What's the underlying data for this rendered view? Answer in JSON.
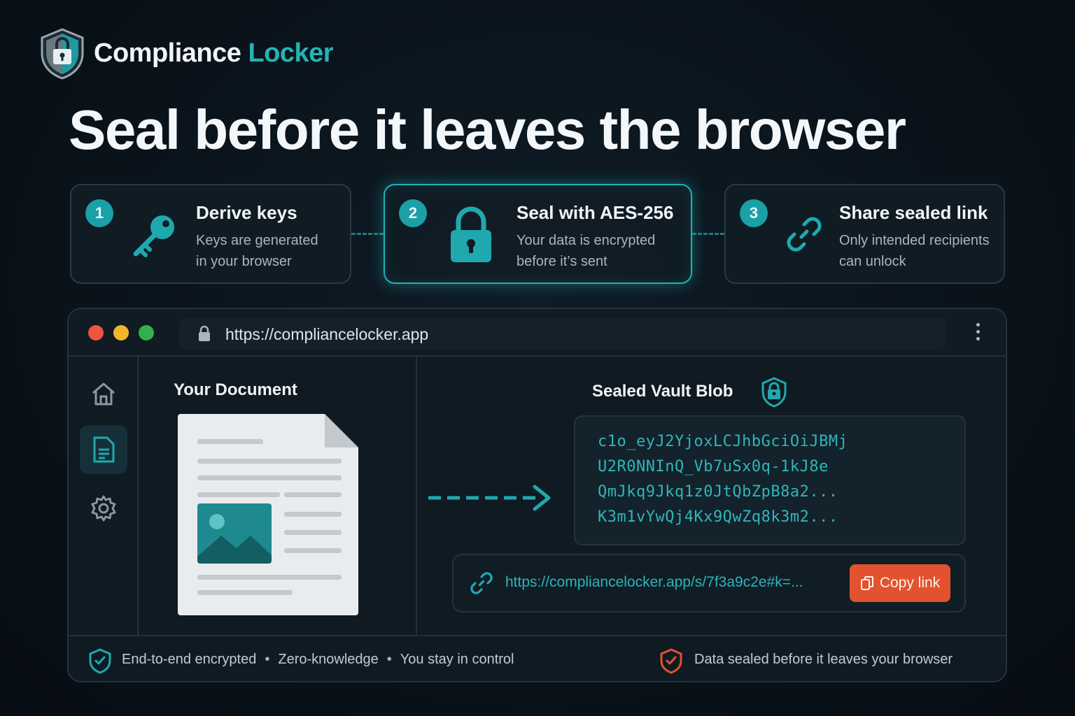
{
  "brand": {
    "name_part1": "Compliance",
    "name_part2": "Locker",
    "logo": "shield-lock-icon"
  },
  "headline": "Seal before it leaves the browser",
  "steps": [
    {
      "number": "1",
      "title": "Derive keys",
      "desc_line1": "Keys are generated",
      "desc_line2": "in your browser",
      "icon": "key-icon"
    },
    {
      "number": "2",
      "title": "Seal with AES-256",
      "desc_line1": "Your data is encrypted",
      "desc_line2": "before it’s sent",
      "icon": "padlock-icon"
    },
    {
      "number": "3",
      "title": "Share sealed link",
      "desc_line1": "Only intended recipients",
      "desc_line2": "can unlock",
      "icon": "link-icon"
    }
  ],
  "browser": {
    "url": "https://compliancelocker.app",
    "traffic_lights": [
      "#f0533f",
      "#f2b62b",
      "#34b04a"
    ],
    "sidebar": [
      "home-icon",
      "document-icon",
      "gear-icon"
    ]
  },
  "document_panel": {
    "title": "Your Document"
  },
  "vault": {
    "title": "Sealed Vault Blob",
    "blob_lines": [
      "c1o_eyJ2YjoxLCJhbGciOiJBMj",
      "U2R0NNInQ_Vb7uSx0q-1kJ8e",
      "QmJkq9Jkq1z0JtQbZpB8a2...",
      "K3m1vYwQj4Kx9QwZq8k3m2..."
    ]
  },
  "share": {
    "link": "https://compliancelocker.app/s/7f3a9c2e#k=...",
    "copy_label": "Copy link"
  },
  "footer": {
    "left": [
      "End-to-end encrypted",
      "Zero-knowledge",
      "You stay in control"
    ],
    "separator": "•",
    "right": "Data sealed before it leaves your browser"
  },
  "colors": {
    "accent": "#26b3b3",
    "orange": "#e2522e",
    "background": "#0a131b"
  }
}
